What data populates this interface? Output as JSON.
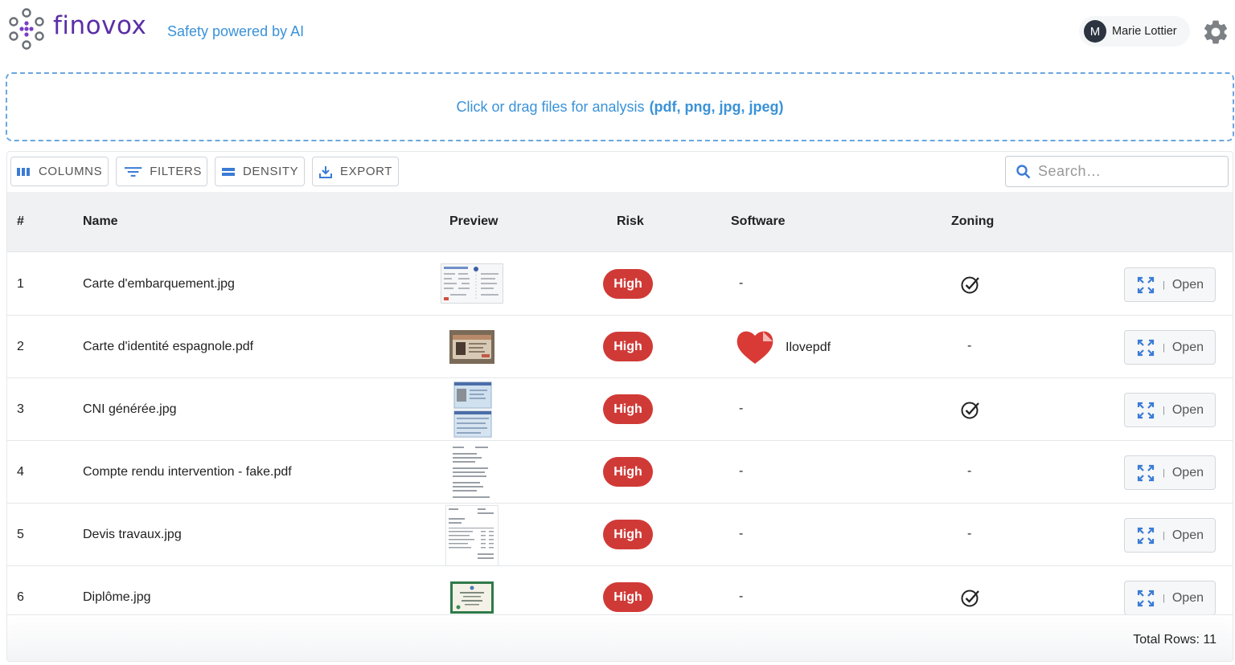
{
  "app": {
    "brand": "finovox",
    "tagline": "Safety powered by AI",
    "user": {
      "initial": "M",
      "name": "Marie Lottier"
    }
  },
  "upload": {
    "text": "Click or drag files for analysis",
    "formats": "(pdf, png, jpg, jpeg)"
  },
  "toolbar": {
    "columns": "COLUMNS",
    "filters": "FILTERS",
    "density": "DENSITY",
    "export": "EXPORT",
    "search_placeholder": "Search…"
  },
  "table": {
    "headers": {
      "num": "#",
      "name": "Name",
      "preview": "Preview",
      "risk": "Risk",
      "software": "Software",
      "zoning": "Zoning"
    },
    "rows": [
      {
        "num": "1",
        "name": "Carte d'embarquement.jpg",
        "risk": "High",
        "software": "-",
        "zoning": "check",
        "open": "Open"
      },
      {
        "num": "2",
        "name": "Carte d'identité espagnole.pdf",
        "risk": "High",
        "software": "Ilovepdf",
        "zoning": "-",
        "open": "Open"
      },
      {
        "num": "3",
        "name": "CNI générée.jpg",
        "risk": "High",
        "software": "-",
        "zoning": "check",
        "open": "Open"
      },
      {
        "num": "4",
        "name": "Compte rendu intervention - fake.pdf",
        "risk": "High",
        "software": "-",
        "zoning": "-",
        "open": "Open"
      },
      {
        "num": "5",
        "name": "Devis travaux.jpg",
        "risk": "High",
        "software": "-",
        "zoning": "-",
        "open": "Open"
      },
      {
        "num": "6",
        "name": "Diplôme.jpg",
        "risk": "High",
        "software": "-",
        "zoning": "check",
        "open": "Open"
      }
    ],
    "total": "Total Rows: 11"
  },
  "colors": {
    "brand": "#5b2ea6",
    "accent": "#3a92d8",
    "risk_high": "#d03a36",
    "software_logo": "#d93a35"
  }
}
